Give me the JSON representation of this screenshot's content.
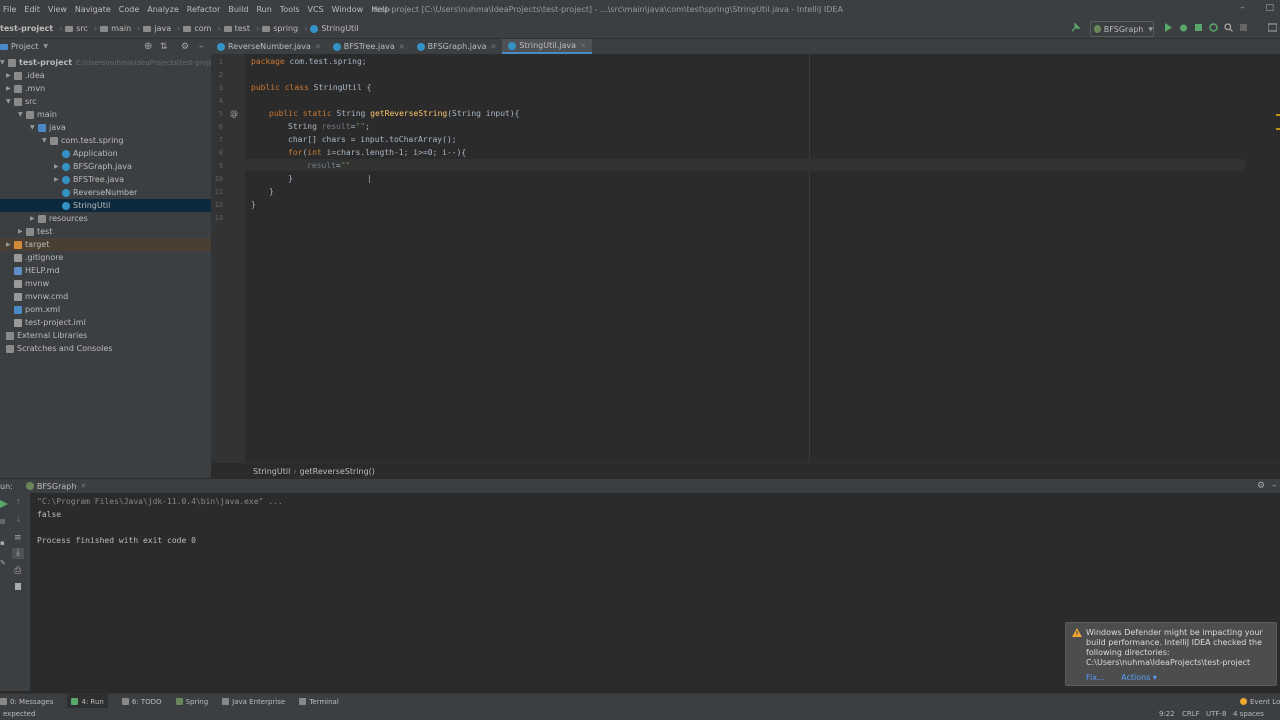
{
  "menu": [
    "File",
    "Edit",
    "View",
    "Navigate",
    "Code",
    "Analyze",
    "Refactor",
    "Build",
    "Run",
    "Tools",
    "VCS",
    "Window",
    "Help"
  ],
  "window_title": "test-project [C:\\Users\\nuhma\\IdeaProjects\\test-project] - ...\\src\\main\\java\\com\\test\\spring\\StringUtil.java - IntelliJ IDEA",
  "breadcrumb": [
    "test-project",
    "src",
    "main",
    "java",
    "com",
    "test",
    "spring",
    "StringUtil"
  ],
  "run_config": "BFSGraph",
  "project_panel": {
    "title": "Project",
    "items": [
      {
        "label": "test-project",
        "path": "C:\\Users\\nuhma\\IdeaProjects\\test-project"
      },
      {
        "label": ".idea"
      },
      {
        "label": ".mvn"
      },
      {
        "label": "src"
      },
      {
        "label": "main"
      },
      {
        "label": "java"
      },
      {
        "label": "com.test.spring"
      },
      {
        "label": "Application"
      },
      {
        "label": "BFSGraph.java"
      },
      {
        "label": "BFSTree.java"
      },
      {
        "label": "ReverseNumber"
      },
      {
        "label": "StringUtil"
      },
      {
        "label": "resources"
      },
      {
        "label": "test"
      },
      {
        "label": "target"
      },
      {
        "label": ".gitignore"
      },
      {
        "label": "HELP.md"
      },
      {
        "label": "mvnw"
      },
      {
        "label": "mvnw.cmd"
      },
      {
        "label": "pom.xml"
      },
      {
        "label": "test-project.iml"
      },
      {
        "label": "External Libraries"
      },
      {
        "label": "Scratches and Consoles"
      }
    ]
  },
  "tabs": [
    "ReverseNumber.java",
    "BFSTree.java",
    "BFSGraph.java",
    "StringUtil.java"
  ],
  "code": {
    "line_numbers": [
      "1",
      "2",
      "3",
      "4",
      "5",
      "6",
      "7",
      "8",
      "9",
      "10",
      "11",
      "12",
      "13"
    ],
    "l1_kw": "package",
    "l1_rest": " com.test.spring;",
    "l3_kw1": "public",
    "l3_kw2": "class",
    "l3_rest": " StringUtil {",
    "l5_kw1": "public",
    "l5_kw2": "static",
    "l5_type": " String ",
    "l5_fn": "getReverseString",
    "l5_rest": "(String input){",
    "l6_type": "String ",
    "l6_var": "result",
    "l6_eq": "=",
    "l6_str": "\"\"",
    "l6_end": ";",
    "l7": "char[] chars = input.toCharArray();",
    "l8_kw": "for",
    "l8_a": "(",
    "l8_int": "int",
    "l8_rest": " i=chars.length-1; i>=0; i--){",
    "l9_var": "result",
    "l9_eq": "=",
    "l9_str": "\"\"",
    "l10": "}",
    "l11": "}",
    "l12": "}"
  },
  "editor_breadcrumb": [
    "StringUtil",
    "getReverseString()"
  ],
  "run_panel": {
    "label": "un:",
    "tab": "BFSGraph",
    "lines": [
      "\"C:\\Program Files\\Java\\jdk-11.0.4\\bin\\java.exe\" ...",
      "false",
      "",
      "Process finished with exit code 0"
    ]
  },
  "tool_windows": [
    "0: Messages",
    "4: Run",
    "6: TODO",
    "Spring",
    "Java Enterprise",
    "Terminal"
  ],
  "event_log": "Event Log",
  "status": {
    "left": "expected",
    "position": "9:22",
    "line_sep": "CRLF",
    "encoding": "UTF-8",
    "indent": "4 spaces"
  },
  "notification": {
    "text": "Windows Defender might be impacting your build performance. IntelliJ IDEA checked the following directories:",
    "path": "C:\\Users\\nuhma\\IdeaProjects\\test-project",
    "fix": "Fix...",
    "actions": "Actions ▾"
  },
  "colors": {
    "accent": "#4a88c7",
    "keyword": "#cc7832",
    "string": "#6a8759",
    "method": "#ffc66d",
    "selection": "#0d293e"
  }
}
